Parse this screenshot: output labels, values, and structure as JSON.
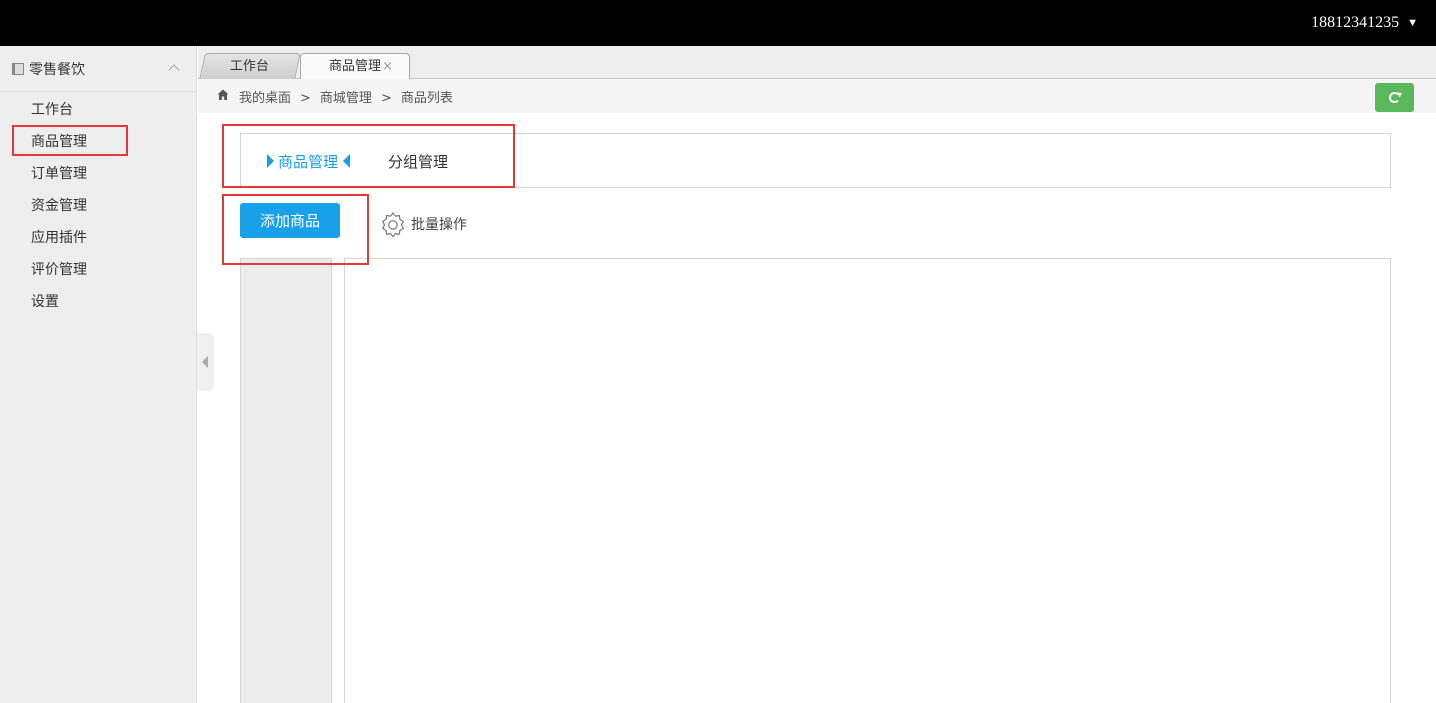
{
  "topbar": {
    "user": "18812341235",
    "caret": "▼"
  },
  "sidebar": {
    "section_title": "零售餐饮",
    "items": [
      {
        "label": "工作台"
      },
      {
        "label": "商品管理"
      },
      {
        "label": "订单管理"
      },
      {
        "label": "资金管理"
      },
      {
        "label": "应用插件"
      },
      {
        "label": "评价管理"
      },
      {
        "label": "设置"
      }
    ]
  },
  "tabs": [
    {
      "label": "工作台"
    },
    {
      "label": "商品管理",
      "close": "×"
    }
  ],
  "breadcrumb": {
    "items": [
      "我的桌面",
      "商城管理",
      "商品列表"
    ],
    "sep": ">"
  },
  "subnav": {
    "active": "商品管理",
    "other": "分组管理"
  },
  "actions": {
    "add_button": "添加商品",
    "batch_label": "批量操作"
  },
  "colors": {
    "accent": "#18a1ea",
    "refresh": "#5cb85c",
    "annotation": "#e53935",
    "topbar": "#000000"
  }
}
